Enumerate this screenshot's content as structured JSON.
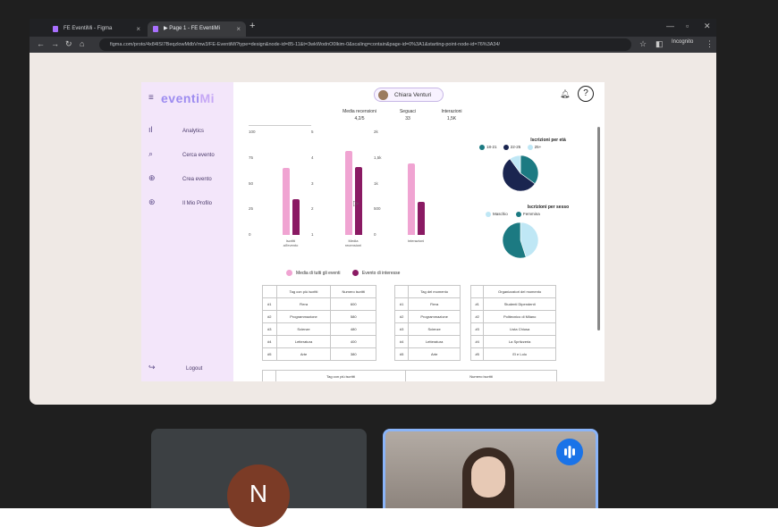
{
  "browser": {
    "tabs": [
      {
        "label": "FE EventiMi - Figma"
      },
      {
        "label": "▶ Page 1 - FE EventiMi"
      }
    ],
    "url": "figma.com/proto/4x84ISI7BeqzlowMdbVmw3/FE-EventiMi?type=design&node-id=85-11&t=3wkWodnO0lkim-0&scaling=contain&page-id=0%3A1&starting-point-node-id=76%3A34/",
    "incognito_label": "Incognito"
  },
  "app": {
    "logo_main": "eventi",
    "logo_accent": "Mi",
    "nav": [
      {
        "label": "Analytics"
      },
      {
        "label": "Cerca evento"
      },
      {
        "label": "Crea evento"
      },
      {
        "label": "Il Mio Profilo"
      }
    ],
    "logout": "Logout",
    "user_name": "Chiara Venturi",
    "stats": [
      {
        "label": "Media recensioni",
        "value": "4,2/5"
      },
      {
        "label": "Seguaci",
        "value": "33"
      },
      {
        "label": "Interazioni",
        "value": "1,5K"
      }
    ]
  },
  "chart_data": [
    {
      "type": "bar",
      "categories": [
        "Iscritti all'evento",
        "Media recensioni",
        "Interazioni"
      ],
      "axes": [
        {
          "ticks": [
            "100",
            "75",
            "50",
            "25",
            "0"
          ],
          "max": 100
        },
        {
          "ticks": [
            "5",
            "4",
            "3",
            "2",
            "1"
          ],
          "max": 5
        },
        {
          "ticks": [
            "2k",
            "1,5k",
            "1k",
            "500",
            "0"
          ],
          "max": 2000
        }
      ],
      "series": [
        {
          "name": "Media di tutti gli eventi",
          "color": "#f0a4d2",
          "values": [
            65,
            4.1,
            1400
          ]
        },
        {
          "name": "Evento di interesse",
          "color": "#8a1a63",
          "values": [
            35,
            3.3,
            650
          ]
        }
      ]
    },
    {
      "type": "pie",
      "title": "Iscrizioni per età",
      "labels": [
        "18-21",
        "22-25",
        "25+"
      ],
      "colors": [
        "#1c7a82",
        "#1a2550",
        "#bfe7f5"
      ],
      "values": [
        35,
        55,
        10
      ]
    },
    {
      "type": "pie",
      "title": "Iscrizioni per sesso",
      "labels": [
        "Maschio",
        "Femmina"
      ],
      "colors": [
        "#bfe7f5",
        "#1c7a82"
      ],
      "values": [
        45,
        55
      ]
    }
  ],
  "tables": [
    {
      "headers": [
        "",
        "Tag con più iscritti",
        "Numero iscritti"
      ],
      "rows": [
        [
          "#1",
          "Fiera",
          "600"
        ],
        [
          "#2",
          "Programmazione",
          "580"
        ],
        [
          "#3",
          "Scienze",
          "480"
        ],
        [
          "#4",
          "Letteratura",
          "400"
        ],
        [
          "#5",
          "Arte",
          "380"
        ]
      ]
    },
    {
      "headers": [
        "",
        "Tag del momento"
      ],
      "rows": [
        [
          "#1",
          "Fiera"
        ],
        [
          "#2",
          "Programmazione"
        ],
        [
          "#3",
          "Scienze"
        ],
        [
          "#4",
          "Letteratura"
        ],
        [
          "#5",
          "Arte"
        ]
      ]
    },
    {
      "headers": [
        "",
        "Organizzatori del momento"
      ],
      "rows": [
        [
          "#1",
          "Studenti Dipendenti"
        ],
        [
          "#2",
          "Politecnico di Milano"
        ],
        [
          "#3",
          "Lista Chiusa"
        ],
        [
          "#4",
          "La Spritzzeria"
        ],
        [
          "#5",
          "El e Lolo"
        ]
      ]
    }
  ],
  "bottom_table_headers": [
    "Tag con più iscritti",
    "Numero iscritti"
  ],
  "meet": {
    "participant_initial": "N"
  }
}
